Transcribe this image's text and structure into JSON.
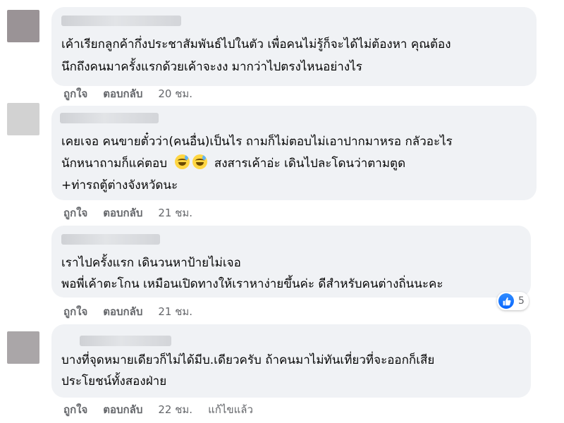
{
  "comments": [
    {
      "lines": [
        "เค้าเรียกลูกค้ากึ่งประชาสัมพันธ์ไปในตัว เพื่อคนไม่รู้ก็จะได้ไม่ต้องหา คุณต้อง",
        "นึกถึงคนมาครั้งแรกด้วยเค้าจะงง มากว่าไปตรงไหนอย่างไร"
      ],
      "like_label": "ถูกใจ",
      "reply_label": "ตอบกลับ",
      "time": "20 ชม."
    },
    {
      "lines": [
        "เคยเจอ คนขายตั๋วว่า(คนอื่น)เป็นไร ถามก็ไม่ตอบไม่เอาปากมาหรอ กลัวอะไร",
        "นักหนาถามก็แค่ตอบ",
        "สงสารเค้าอ่ะ เดินไปละโดนว่าตามตูด",
        "+ท่ารถตู้ต่างจังหวัดนะ"
      ],
      "emojis": [
        "sweat-smile-emoji",
        "sweat-smile-emoji"
      ],
      "like_label": "ถูกใจ",
      "reply_label": "ตอบกลับ",
      "time": "21 ชม."
    },
    {
      "lines": [
        "เราไปครั้งแรก เดินวนหาป้ายไม่เจอ",
        "พอพี่เค้าตะโกน เหมือนเปิดทางให้เราหาง่ายขึ้นค่ะ ดีสำหรับคนต่างถิ่นนะคะ"
      ],
      "reaction": {
        "icon": "like-icon",
        "count": "5"
      },
      "like_label": "ถูกใจ",
      "reply_label": "ตอบกลับ",
      "time": "21 ชม."
    },
    {
      "lines": [
        "บางที่จุดหมายเดียวก็ไม่ได้มีบ.เดียวครับ ถ้าคนมาไม่ทันเที่ยวที่จะออกก็เสีย",
        "ประโยชน์ทั้งสองฝ่าย"
      ],
      "like_label": "ถูกใจ",
      "reply_label": "ตอบกลับ",
      "time": "22 ชม.",
      "edited_label": "แก้ไขแล้ว"
    }
  ],
  "colors": {
    "bubble": "#f0f2f5",
    "action_text": "#65676b",
    "like_blue": "#0866ff"
  }
}
